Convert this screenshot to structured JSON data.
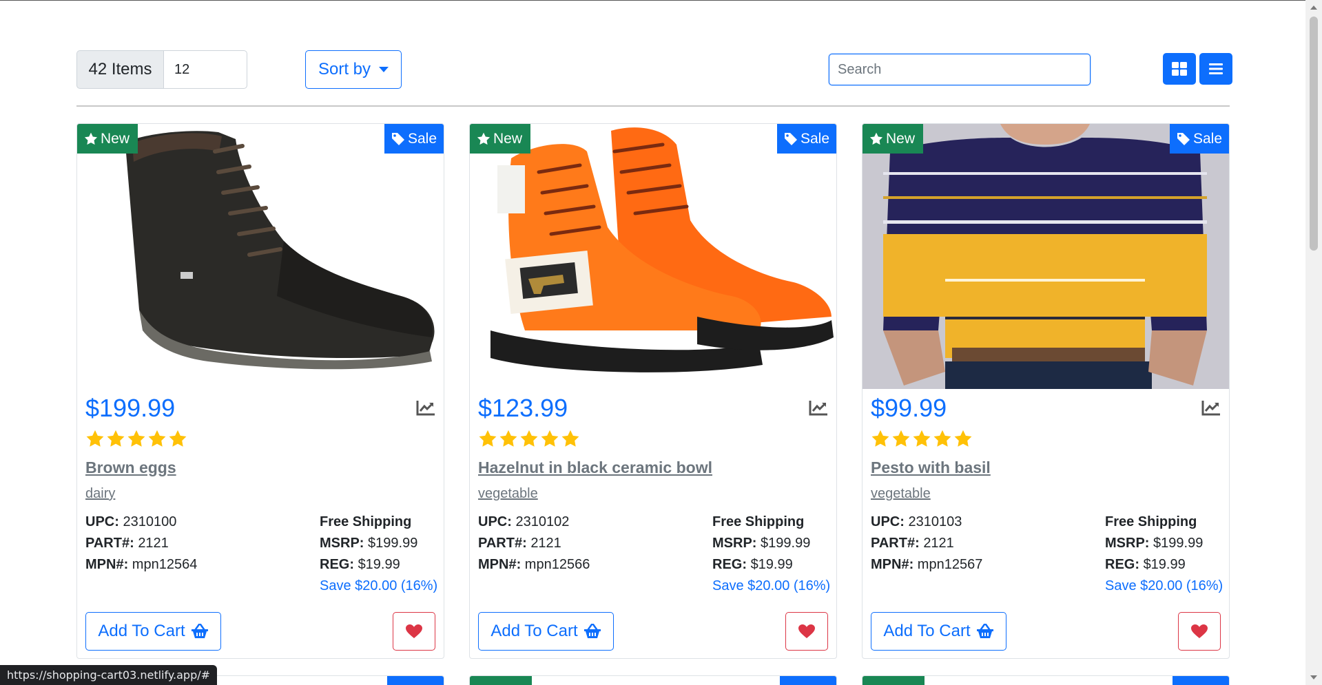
{
  "toolbar": {
    "items_label": "42 Items",
    "per_page_value": "12",
    "sort_label": "Sort by",
    "search_placeholder": "Search"
  },
  "products": [
    {
      "price": "$199.99",
      "rating": 5,
      "title": "Brown eggs",
      "category": "dairy",
      "upc_label": "UPC:",
      "upc": "2310100",
      "part_label": "PART#:",
      "part": "2121",
      "mpn_label": "MPN#:",
      "mpn": "mpn12564",
      "shipping": "Free Shipping",
      "msrp_label": "MSRP:",
      "msrp": "$199.99",
      "reg_label": "REG:",
      "reg": "$19.99",
      "save": "Save $20.00 (16%)",
      "badge_new": "New",
      "badge_sale": "Sale",
      "cart_label": "Add To Cart",
      "image": "dark-leather-boot"
    },
    {
      "price": "$123.99",
      "rating": 5,
      "title": "Hazelnut in black ceramic bowl",
      "category": "vegetable",
      "upc_label": "UPC:",
      "upc": "2310102",
      "part_label": "PART#:",
      "part": "2121",
      "mpn_label": "MPN#:",
      "mpn": "mpn12566",
      "shipping": "Free Shipping",
      "msrp_label": "MSRP:",
      "msrp": "$199.99",
      "reg_label": "REG:",
      "reg": "$19.99",
      "save": "Save $20.00 (16%)",
      "badge_new": "New",
      "badge_sale": "Sale",
      "cart_label": "Add To Cart",
      "image": "orange-work-boots"
    },
    {
      "price": "$99.99",
      "rating": 5,
      "title": "Pesto with basil",
      "category": "vegetable",
      "upc_label": "UPC:",
      "upc": "2310103",
      "part_label": "PART#:",
      "part": "2121",
      "mpn_label": "MPN#:",
      "mpn": "mpn12567",
      "shipping": "Free Shipping",
      "msrp_label": "MSRP:",
      "msrp": "$199.99",
      "reg_label": "REG:",
      "reg": "$19.99",
      "save": "Save $20.00 (16%)",
      "badge_new": "New",
      "badge_sale": "Sale",
      "cart_label": "Add To Cart",
      "image": "striped-tshirt"
    }
  ],
  "status_bar": {
    "url": "https://shopping-cart03.netlify.app/#"
  },
  "colors": {
    "primary": "#0d6efd",
    "success": "#198754",
    "danger": "#dc3545",
    "star": "#ffc107",
    "muted": "#6c757d"
  }
}
